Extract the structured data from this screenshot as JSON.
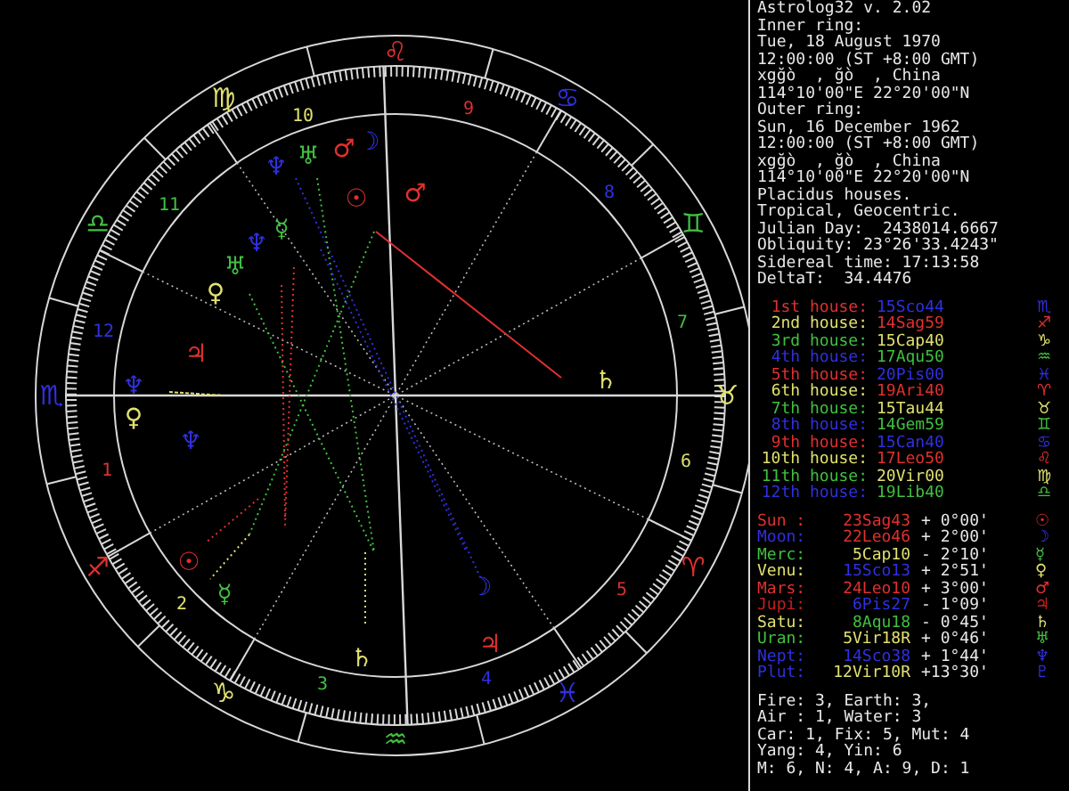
{
  "wheel": {
    "signs": [
      {
        "glyph": "♈",
        "color": "#e03030"
      },
      {
        "glyph": "♉",
        "color": "#e0e070"
      },
      {
        "glyph": "♊",
        "color": "#40c040"
      },
      {
        "glyph": "♋",
        "color": "#3030e0"
      },
      {
        "glyph": "♌",
        "color": "#e03030"
      },
      {
        "glyph": "♍",
        "color": "#e0e070"
      },
      {
        "glyph": "♎",
        "color": "#40c040"
      },
      {
        "glyph": "♏",
        "color": "#3030e0"
      },
      {
        "glyph": "♐",
        "color": "#e03030"
      },
      {
        "glyph": "♑",
        "color": "#e0e070"
      },
      {
        "glyph": "♒",
        "color": "#40c040"
      },
      {
        "glyph": "♓",
        "color": "#3030e0"
      }
    ],
    "house_numbers": [
      {
        "text": "1",
        "color": "#e03030"
      },
      {
        "text": "2",
        "color": "#e0e070"
      },
      {
        "text": "3",
        "color": "#40c040"
      },
      {
        "text": "4",
        "color": "#3030e0"
      },
      {
        "text": "5",
        "color": "#e03030"
      },
      {
        "text": "6",
        "color": "#e0e070"
      },
      {
        "text": "7",
        "color": "#40c040"
      },
      {
        "text": "8",
        "color": "#3030e0"
      },
      {
        "text": "9",
        "color": "#e03030"
      },
      {
        "text": "10",
        "color": "#e0e070"
      },
      {
        "text": "11",
        "color": "#40c040"
      },
      {
        "text": "12",
        "color": "#3030e0"
      }
    ],
    "planet_marks": [
      {
        "glyph": "♂",
        "color": "#e03030"
      },
      {
        "glyph": "☽",
        "color": "#3030e0"
      },
      {
        "glyph": "♅",
        "color": "#40c040"
      },
      {
        "glyph": "♆",
        "color": "#3030e0"
      },
      {
        "glyph": "☉",
        "color": "#e03030"
      },
      {
        "glyph": "♂",
        "color": "#e03030"
      },
      {
        "glyph": "☿",
        "color": "#40c040"
      },
      {
        "glyph": "♆",
        "color": "#3030e0"
      },
      {
        "glyph": "♅",
        "color": "#40c040"
      },
      {
        "glyph": "♀",
        "color": "#e0e070"
      },
      {
        "glyph": "♃",
        "color": "#e03030"
      },
      {
        "glyph": "♆",
        "color": "#3030e0"
      },
      {
        "glyph": "♀",
        "color": "#e0e070"
      },
      {
        "glyph": "♆",
        "color": "#3030e0"
      },
      {
        "glyph": "♄",
        "color": "#e0e070"
      },
      {
        "glyph": "☉",
        "color": "#e03030"
      },
      {
        "glyph": "☿",
        "color": "#40c040"
      },
      {
        "glyph": "♄",
        "color": "#e0e070"
      },
      {
        "glyph": "☽",
        "color": "#3030e0"
      },
      {
        "glyph": "♃",
        "color": "#e03030"
      }
    ]
  },
  "info": [
    "Astrolog32 v. 2.02",
    "Inner ring:",
    "Tue, 18 August 1970",
    "12:00:00 (ST +8:00 GMT)",
    "xgğò  , ğò  , China",
    "114°10'00\"E 22°20'00\"N",
    "Outer ring:",
    "Sun, 16 December 1962",
    "12:00:00 (ST +8:00 GMT)",
    "xgğò  , ğò  , China",
    "114°10'00\"E 22°20'00\"N",
    "Placidus houses.",
    "Tropical, Geocentric.",
    "Julian Day:  2438014.6667",
    "Obliquity: 23°26'33.4243\"",
    "Sidereal time: 17:13:58",
    "DeltaT:  34.4476"
  ],
  "houses": [
    {
      "label": "1st house:",
      "color": "#e03030",
      "cusp": {
        "text": "15Sco44",
        "glyph": "♏",
        "color": "#3030e0"
      }
    },
    {
      "label": "2nd house:",
      "color": "#e0e070",
      "cusp": {
        "text": "14Sag59",
        "glyph": "♐",
        "color": "#e03030"
      }
    },
    {
      "label": "3rd house:",
      "color": "#40c040",
      "cusp": {
        "text": "15Cap40",
        "glyph": "♑",
        "color": "#e0e070"
      }
    },
    {
      "label": "4th house:",
      "color": "#3030e0",
      "cusp": {
        "text": "17Aqu50",
        "glyph": "♒",
        "color": "#40c040"
      }
    },
    {
      "label": "5th house:",
      "color": "#e03030",
      "cusp": {
        "text": "20Pis00",
        "glyph": "♓",
        "color": "#3030e0"
      }
    },
    {
      "label": "6th house:",
      "color": "#e0e070",
      "cusp": {
        "text": "19Ari40",
        "glyph": "♈",
        "color": "#e03030"
      }
    },
    {
      "label": "7th house:",
      "color": "#40c040",
      "cusp": {
        "text": "15Tau44",
        "glyph": "♉",
        "color": "#e0e070"
      }
    },
    {
      "label": "8th house:",
      "color": "#3030e0",
      "cusp": {
        "text": "14Gem59",
        "glyph": "♊",
        "color": "#40c040"
      }
    },
    {
      "label": "9th house:",
      "color": "#e03030",
      "cusp": {
        "text": "15Can40",
        "glyph": "♋",
        "color": "#3030e0"
      }
    },
    {
      "label": "10th house:",
      "color": "#e0e070",
      "cusp": {
        "text": "17Leo50",
        "glyph": "♌",
        "color": "#e03030"
      }
    },
    {
      "label": "11th house:",
      "color": "#40c040",
      "cusp": {
        "text": "20Vir00",
        "glyph": "♍",
        "color": "#e0e070"
      }
    },
    {
      "label": "12th house:",
      "color": "#3030e0",
      "cusp": {
        "text": "19Lib40",
        "glyph": "♎",
        "color": "#40c040"
      }
    }
  ],
  "planets": [
    {
      "name": "Sun :",
      "glyph": "☉",
      "color": "#e03030",
      "offset": "+ 0°00'",
      "position": {
        "text": "23Sag43",
        "color": "#e03030"
      }
    },
    {
      "name": "Moon:",
      "glyph": "☽",
      "color": "#3030e0",
      "offset": "+ 2°00'",
      "position": {
        "text": "22Leo46",
        "color": "#e03030"
      }
    },
    {
      "name": "Merc:",
      "glyph": "☿",
      "color": "#40c040",
      "offset": "- 2°10'",
      "position": {
        "text": "5Cap10",
        "color": "#e0e070"
      }
    },
    {
      "name": "Venu:",
      "glyph": "♀",
      "color": "#e0e070",
      "offset": "+ 2°51'",
      "position": {
        "text": "15Sco13",
        "color": "#3030e0"
      }
    },
    {
      "name": "Mars:",
      "glyph": "♂",
      "color": "#e03030",
      "offset": "+ 3°00'",
      "position": {
        "text": "24Leo10",
        "color": "#e03030"
      }
    },
    {
      "name": "Jupi:",
      "glyph": "♃",
      "color": "#c02020",
      "offset": "- 1°09'",
      "position": {
        "text": "6Pis27",
        "color": "#3030e0"
      }
    },
    {
      "name": "Satu:",
      "glyph": "♄",
      "color": "#e0e070",
      "offset": "- 0°45'",
      "position": {
        "text": "8Aqu18",
        "color": "#40c040"
      }
    },
    {
      "name": "Uran:",
      "glyph": "♅",
      "color": "#40c040",
      "offset": "+ 0°46'",
      "position": {
        "text": "5Vir18R",
        "color": "#e0e070"
      }
    },
    {
      "name": "Nept:",
      "glyph": "♆",
      "color": "#3030e0",
      "offset": "+ 1°44'",
      "position": {
        "text": "14Sco38",
        "color": "#3030e0"
      }
    },
    {
      "name": "Plut:",
      "glyph": "♇",
      "color": "#3030e0",
      "offset": "+13°30'",
      "position": {
        "text": "12Vir10R",
        "color": "#e0e070"
      }
    }
  ],
  "summary": [
    "Fire: 3, Earth: 3,",
    "Air : 1, Water: 3",
    "Car: 1, Fix: 5, Mut: 4",
    "Yang: 4, Yin: 6",
    "M: 6, N: 4, A: 9, D: 1"
  ]
}
